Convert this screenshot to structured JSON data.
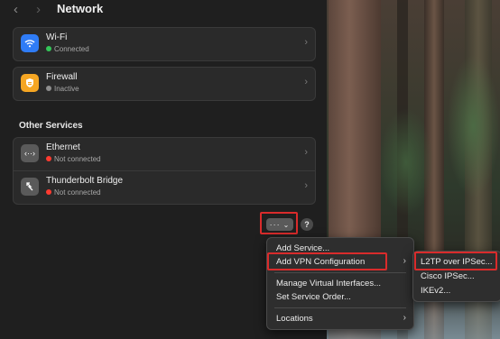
{
  "window": {
    "title": "Network"
  },
  "services": [
    {
      "name": "Wi-Fi",
      "status": "Connected",
      "icon": "wifi-icon",
      "icon_color": "#2f7cf6",
      "status_color": "#34c759"
    },
    {
      "name": "Firewall",
      "status": "Inactive",
      "icon": "shield-icon",
      "icon_color": "#f5a623",
      "status_color": "#8e8e8e"
    }
  ],
  "other_services": {
    "title": "Other Services",
    "items": [
      {
        "name": "Ethernet",
        "status": "Not connected",
        "icon": "ethernet-icon",
        "status_color": "#ff3b30"
      },
      {
        "name": "Thunderbolt Bridge",
        "status": "Not connected",
        "icon": "thunderbolt-icon",
        "status_color": "#ff3b30"
      }
    ]
  },
  "toolbar": {
    "more_label": "···",
    "more_chevron": "⌄",
    "help_label": "?"
  },
  "menu": {
    "items": [
      {
        "label": "Add Service..."
      },
      {
        "label": "Add VPN Configuration",
        "has_submenu": true,
        "highlighted": true
      },
      {
        "label": "Manage Virtual Interfaces..."
      },
      {
        "label": "Set Service Order..."
      },
      {
        "label": "Locations",
        "has_submenu": true
      }
    ]
  },
  "submenu": {
    "items": [
      {
        "label": "L2TP over IPSec...",
        "highlighted": true
      },
      {
        "label": "Cisco IPSec..."
      },
      {
        "label": "IKEv2..."
      }
    ]
  },
  "colors": {
    "highlight": "#d92b2b",
    "panel": "#1f1f1f",
    "card": "#2a2a2a"
  }
}
